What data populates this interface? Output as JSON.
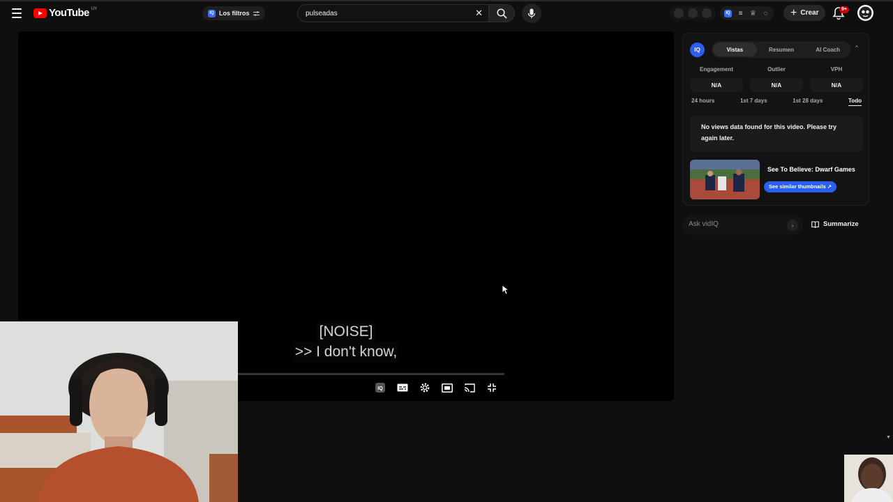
{
  "header": {
    "logo_text": "YouTube",
    "country_code": "UY",
    "filters_label": "Los filtros",
    "search_value": "pulseadas",
    "create_label": "Crear",
    "notifications_badge": "9+"
  },
  "player": {
    "captions": [
      "[NOISE]",
      ">> I don't know,"
    ]
  },
  "vidiq": {
    "logo": "IQ",
    "tabs": [
      "Vistas",
      "Resumen",
      "AI Coach"
    ],
    "active_tab": "Vistas",
    "metrics": [
      {
        "label": "Engagement",
        "value": "N/A"
      },
      {
        "label": "Outlier",
        "value": "N/A"
      },
      {
        "label": "VPH",
        "value": "N/A"
      }
    ],
    "ranges": [
      "24 hours",
      "1st 7 days",
      "1st 28 days",
      "Todo"
    ],
    "active_range": "Todo",
    "no_data_message": "No views data found for this video. Please try again later.",
    "video_title": "See To Believe: Dwarf Games",
    "similar_thumbnails_label": "See similar thumbnails",
    "ask_placeholder": "Ask vidIQ",
    "summarize_label": "Summarize"
  },
  "colors": {
    "youtube_red": "#ff0000",
    "vidiq_blue": "#2d5ef0",
    "background": "#0f0f0f"
  }
}
